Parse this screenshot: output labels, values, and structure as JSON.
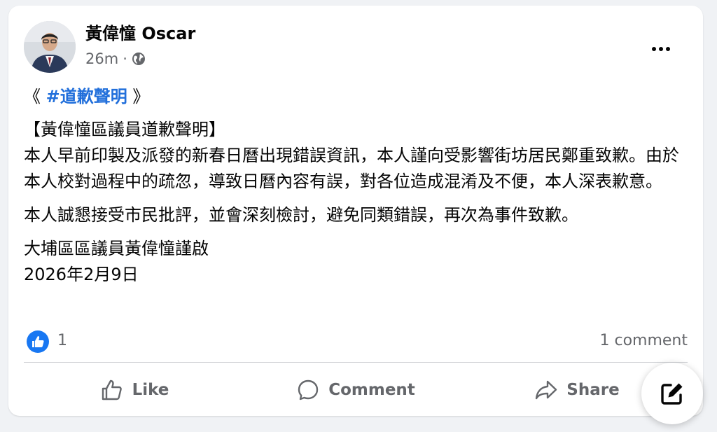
{
  "post": {
    "author": "黃偉憧 Oscar",
    "timestamp": "26m",
    "separator": "·",
    "privacy_icon": "globe-icon",
    "hashtag_open": "《",
    "hashtag": "#道歉聲明",
    "hashtag_close": "》",
    "heading": "【黃偉憧區議員道歉聲明】",
    "paragraph1": "本人早前印製及派發的新春日曆出現錯誤資訊，本人謹向受影響街坊居民鄭重致歉。由於本人校對過程中的疏忽，導致日曆內容有誤，對各位造成混淆及不便，本人深表歉意。",
    "paragraph2": "本人誠懇接受市民批評，並會深刻檢討，避免同類錯誤，再次為事件致歉。",
    "signature": "大埔區區議員黃偉憧謹啟",
    "date": "2026年2月9日"
  },
  "reactions": {
    "like_count": "1",
    "comment_count": "1 comment"
  },
  "actions": {
    "like": "Like",
    "comment": "Comment",
    "share": "Share"
  },
  "colors": {
    "accent": "#1877f2",
    "hashtag": "#216fdb",
    "secondary_text": "#65676b",
    "background": "#f0f2f5"
  }
}
